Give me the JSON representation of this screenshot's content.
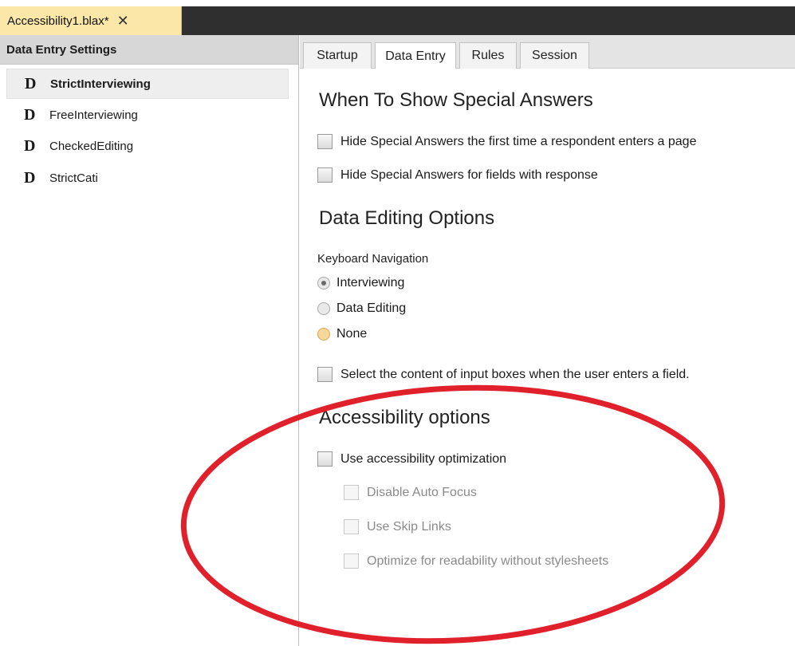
{
  "document_tab": {
    "title": "Accessibility1.blax*",
    "close_glyph": "✕"
  },
  "sidebar": {
    "header": "Data Entry Settings",
    "icon_glyph": "D",
    "items": [
      {
        "label": "StrictInterviewing",
        "selected": true
      },
      {
        "label": "FreeInterviewing",
        "selected": false
      },
      {
        "label": "CheckedEditing",
        "selected": false
      },
      {
        "label": "StrictCati",
        "selected": false
      }
    ]
  },
  "tabs": [
    {
      "label": "Startup",
      "active": false
    },
    {
      "label": "Data Entry",
      "active": true
    },
    {
      "label": "Rules",
      "active": false
    },
    {
      "label": "Session",
      "active": false
    }
  ],
  "sections": {
    "special_answers": {
      "heading": "When To Show Special Answers",
      "options": [
        "Hide Special Answers the first time a respondent enters a page",
        "Hide Special Answers for fields with response"
      ]
    },
    "data_editing": {
      "heading": "Data Editing Options",
      "keyboard_nav_label": "Keyboard Navigation",
      "radios": [
        "Interviewing",
        "Data Editing",
        "None"
      ],
      "selected_radio": "Interviewing",
      "select_content_option": "Select the content of input boxes when the user enters a field."
    },
    "accessibility": {
      "heading": "Accessibility options",
      "main_option": "Use accessibility optimization",
      "sub_options": [
        "Disable Auto Focus",
        "Use Skip Links",
        "Optimize for readability without stylesheets"
      ]
    }
  },
  "colors": {
    "annotation_circle": "#e0202a",
    "document_tab_bg": "#fbe8a8",
    "document_bar_bg": "#2f2f2f"
  }
}
